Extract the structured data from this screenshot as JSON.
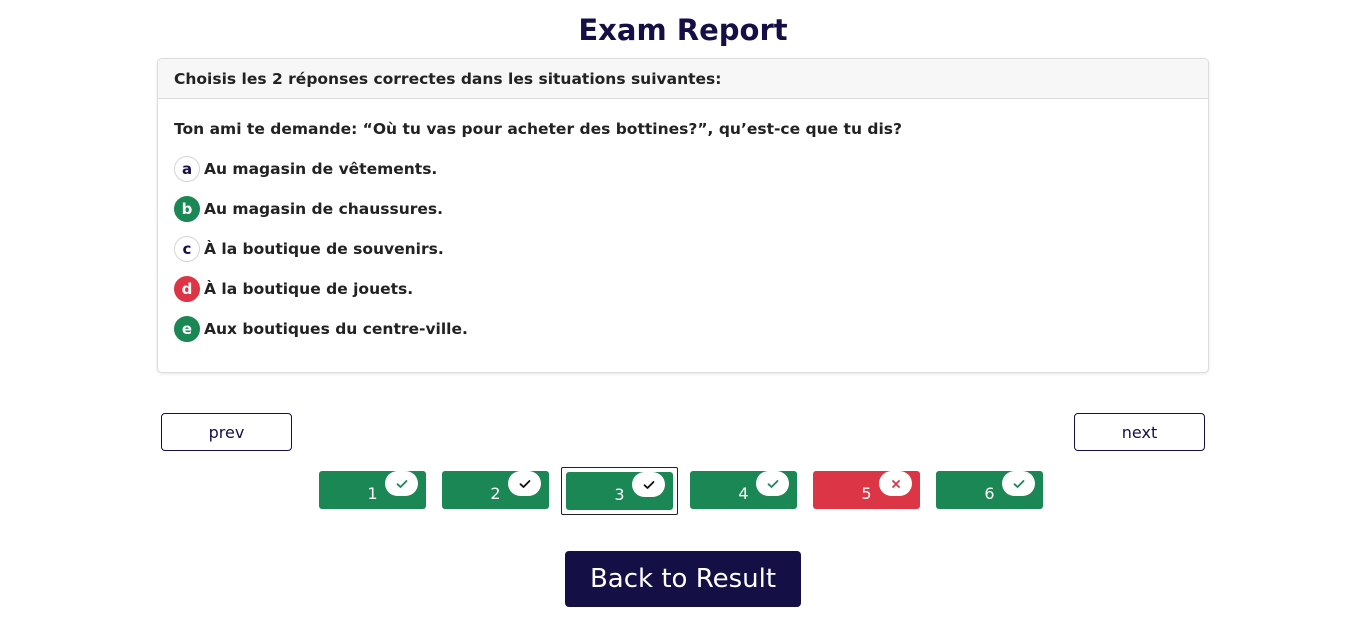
{
  "page": {
    "title": "Exam Report"
  },
  "question_card": {
    "instruction": "Choisis les 2 réponses correctes dans les situations suivantes:",
    "question": "Ton ami te demande: “Où tu vas pour acheter des bottines?”, qu’est-ce que tu dis?",
    "options": [
      {
        "letter": "a",
        "text": "Au magasin de vêtements.",
        "status": "unselected"
      },
      {
        "letter": "b",
        "text": "Au magasin de chaussures.",
        "status": "correct"
      },
      {
        "letter": "c",
        "text": "À la boutique de souvenirs.",
        "status": "unselected"
      },
      {
        "letter": "d",
        "text": "À la boutique de jouets.",
        "status": "wrong"
      },
      {
        "letter": "e",
        "text": "Aux boutiques du centre-ville.",
        "status": "correct"
      }
    ]
  },
  "navigation": {
    "prev_label": "prev",
    "next_label": "next"
  },
  "question_nav": [
    {
      "label": "1",
      "result": "correct",
      "current": false
    },
    {
      "label": "2",
      "result": "correct",
      "current": false
    },
    {
      "label": "3",
      "result": "correct",
      "current": true
    },
    {
      "label": "4",
      "result": "correct",
      "current": false
    },
    {
      "label": "5",
      "result": "incorrect",
      "current": false
    },
    {
      "label": "6",
      "result": "correct",
      "current": false
    }
  ],
  "icons": {
    "correct": "check-icon",
    "incorrect": "x-icon"
  },
  "colors": {
    "primary": "#140f45",
    "correct": "#1a8754",
    "wrong": "#dc3545"
  },
  "footer": {
    "back_label": "Back to Result"
  }
}
